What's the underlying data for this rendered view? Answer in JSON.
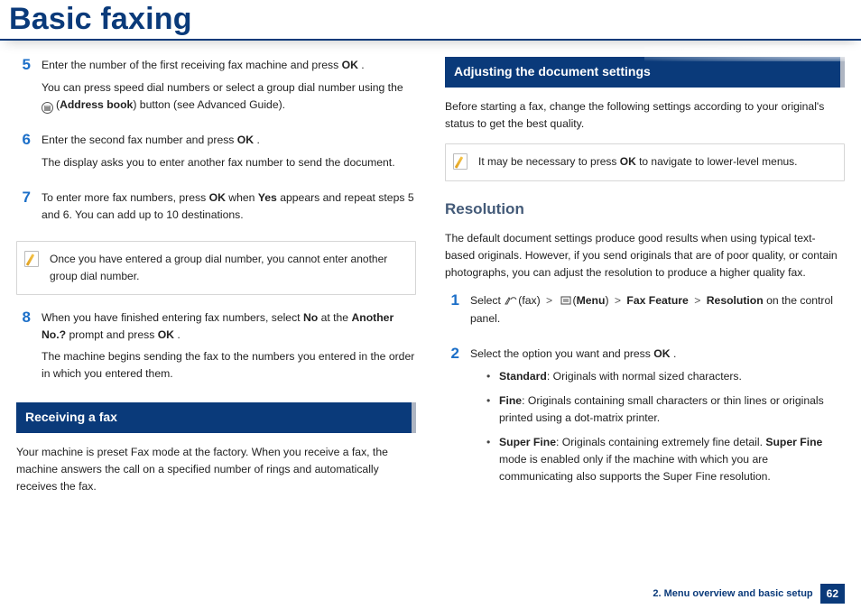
{
  "header": {
    "title": "Basic faxing"
  },
  "left": {
    "steps": {
      "5": {
        "p1_a": "Enter the number of the first receiving fax machine and press ",
        "p1_b": "OK",
        "p1_c": ".",
        "p2_a": "You can press speed dial numbers or select a group dial number using the ",
        "p2_b": "Address book",
        "p2_c": ") button (see Advanced Guide)."
      },
      "6": {
        "p1_a": "Enter the second fax number and press ",
        "p1_b": "OK",
        "p1_c": ".",
        "p2": "The display asks you to enter another fax number to send the document."
      },
      "7": {
        "p1_a": "To enter more fax numbers, press ",
        "p1_b": "OK",
        "p1_c": " when ",
        "p1_d": "Yes",
        "p1_e": " appears and repeat steps 5 and 6. You can add up to 10 destinations."
      },
      "8": {
        "p1_a": "When you have finished entering fax numbers, select ",
        "p1_b": "No",
        "p1_c": " at the ",
        "p1_d": "Another No.?",
        "p1_e": " prompt and press ",
        "p1_f": "OK",
        "p1_g": ".",
        "p2": "The machine begins sending the fax to the numbers you entered in the order in which you entered them."
      }
    },
    "note": "Once you have entered a group dial number, you cannot enter another group dial number.",
    "section": "Receiving a fax",
    "receiving_text": "Your machine is preset Fax mode at the factory. When you receive a fax, the machine answers the call on a specified number of rings and automatically receives the fax."
  },
  "right": {
    "section": "Adjusting the document settings",
    "intro": "Before starting a fax, change the following settings according to your original's status to get the best quality.",
    "note_a": "It may be necessary to press ",
    "note_b": "OK",
    "note_c": " to navigate to lower-level menus.",
    "sub": "Resolution",
    "res_para": "The default document settings produce good results when using typical text-based originals. However, if you send originals that are of poor quality, or contain photographs, you can adjust the resolution to produce a higher quality fax.",
    "steps": {
      "1": {
        "a": "Select ",
        "fax": "(fax)",
        "gt": ">",
        "menu": "Menu",
        "feat": "Fax Feature",
        "res": "Resolution",
        "tail": " on the control panel."
      },
      "2": {
        "a": "Select the option you want and press ",
        "b": "OK",
        "c": "."
      }
    },
    "bullets": {
      "std_l": "Standard",
      "std_t": ": Originals with normal sized characters.",
      "fine_l": "Fine",
      "fine_t": ": Originals containing small characters or thin lines or originals printed using a dot-matrix printer.",
      "sf_l": "Super Fine",
      "sf_t1": ": Originals containing extremely fine detail. ",
      "sf_b": "Super Fine",
      "sf_t2": " mode is enabled only if the machine with which you are communicating also supports the Super Fine resolution."
    }
  },
  "footer": {
    "chapter": "2. Menu overview and basic setup",
    "page": "62"
  }
}
